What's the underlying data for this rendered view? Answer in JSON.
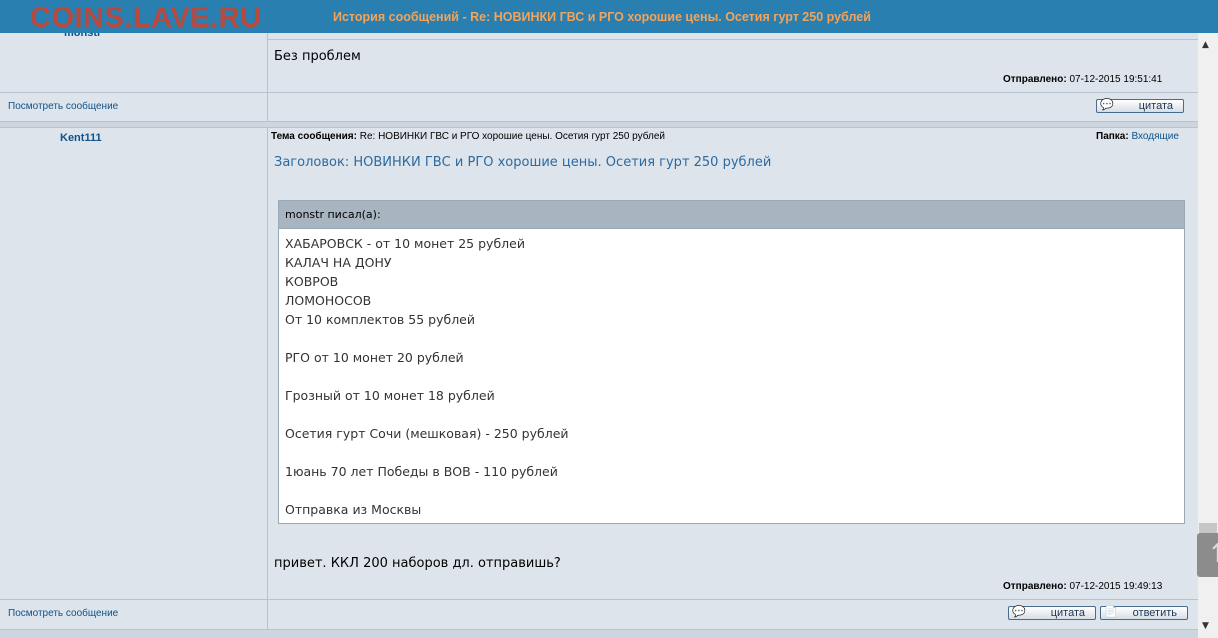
{
  "window": {
    "watermark": "COINS.LAVE.RU",
    "title": "История сообщений - Re: НОВИНКИ ГВС и РГО хорошие цены. Осетия гурт 250 рублей"
  },
  "post1": {
    "author_partial": "monstr",
    "body": "Без проблем",
    "sent_label": "Отправлено:",
    "sent_value": "07-12-2015 19:51:41",
    "view_link": "Посмотреть сообщение",
    "quote_button": "цитата"
  },
  "post2": {
    "author": "Kent111",
    "topic_label": "Тема сообщения:",
    "topic_value": "Re: НОВИНКИ ГВС и РГО хорошие цены. Осетия гурт 250 рублей",
    "folder_label": "Папка:",
    "folder_value": "Входящие",
    "subject": "Заголовок: НОВИНКИ ГВС и РГО хорошие цены. Осетия гурт 250 рублей",
    "quote_author": "monstr писал(а):",
    "quote_lines": [
      "ХАБАРОВСК - от 10 монет 25 рублей",
      "КАЛАЧ НА ДОНУ",
      "КОВРОВ",
      "ЛОМОНОСОВ",
      "От 10 комплектов 55 рублей",
      "РГО от 10 монет 20 рублей",
      "Грозный от 10 монет 18 рублей",
      "Осетия гурт Сочи (мешковая) - 250 рублей",
      "1юань 70 лет Победы в ВОВ - 110 рублей",
      "Отправка из Москвы"
    ],
    "body": "привет. ККЛ 200 наборов дл. отправишь?",
    "sent_label": "Отправлено:",
    "sent_value": "07-12-2015 19:49:13",
    "view_link": "Посмотреть сообщение",
    "quote_button": "цитата",
    "reply_button": "ответить"
  },
  "icons": {
    "quote": "quote-bubble-icon",
    "reply": "reply-document-icon",
    "scroll_up": "scroll-up-arrow-icon",
    "scroll_down": "scroll-down-arrow-icon"
  }
}
